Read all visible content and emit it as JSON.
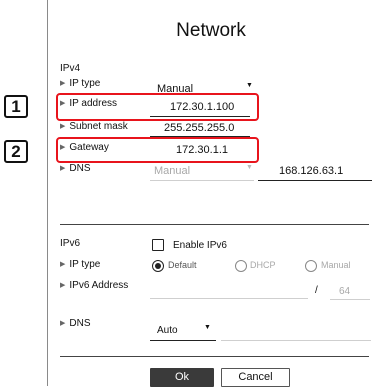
{
  "dialog": {
    "title": "Network",
    "ok_label": "Ok",
    "cancel_label": "Cancel"
  },
  "callouts": [
    "1",
    "2"
  ],
  "ipv4": {
    "section_label": "IPv4",
    "ip_type_label": "IP type",
    "ip_type_value": "Manual",
    "ip_address_label": "IP address",
    "ip_address_value": "172.30.1.100",
    "subnet_mask_label": "Subnet mask",
    "subnet_mask_value": "255.255.255.0",
    "gateway_label": "Gateway",
    "gateway_value": "172.30.1.1",
    "dns_label": "DNS",
    "dns_mode_value": "Manual",
    "dns_server_value": "168.126.63.1"
  },
  "ipv6": {
    "section_label": "IPv6",
    "enable_label": "Enable IPv6",
    "enable_checked": false,
    "ip_type_label": "IP type",
    "ip_type_options": [
      "Default",
      "DHCP",
      "Manual"
    ],
    "ip_type_selected": "Default",
    "address_label": "IPv6 Address",
    "address_value": "",
    "prefix_separator": "/",
    "prefix_value": "64",
    "dns_label": "DNS",
    "dns_mode_value": "Auto"
  },
  "colors": {
    "highlight": "#e8141c",
    "ok_button": "#3a3a3a",
    "disabled_text": "#a8a8a8"
  }
}
